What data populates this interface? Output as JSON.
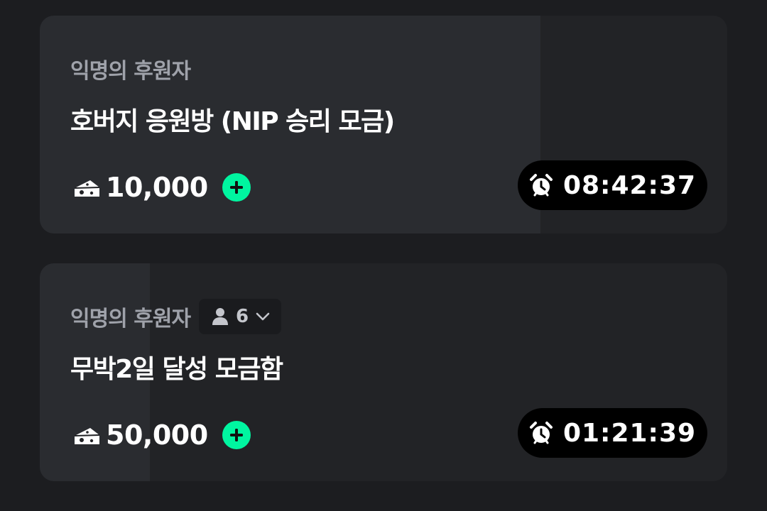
{
  "donations": [
    {
      "sponsor": "익명의 후원자",
      "title": "호버지 응원방 (NIP 승리 모금)",
      "amount": "10,000",
      "timer": "08:42:37",
      "progress": 0.728,
      "people_count": null
    },
    {
      "sponsor": "익명의 후원자",
      "title": "무박2일 달성 모금함",
      "amount": "50,000",
      "timer": "01:21:39",
      "progress": 0.16,
      "people_count": "6"
    }
  ],
  "icons": {
    "currency": "cheese-icon",
    "add": "plus-circle-icon",
    "timer": "alarm-clock-icon",
    "people": "person-icon",
    "expand": "chevron-down-icon"
  },
  "colors": {
    "background": "#1c1d20",
    "card": "#222326",
    "progress": "#2a2c30",
    "accent": "#00f5a0",
    "timer_bg": "#000000"
  }
}
